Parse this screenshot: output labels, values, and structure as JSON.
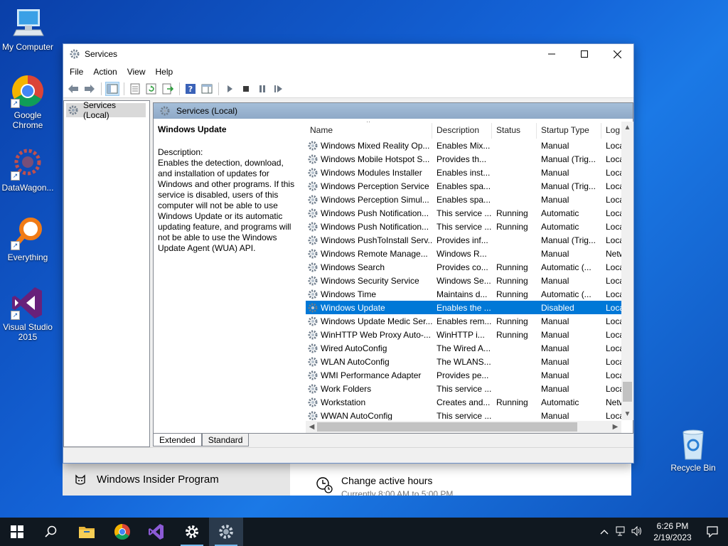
{
  "desktop": {
    "icons": [
      {
        "label": "My Computer"
      },
      {
        "label": "Google Chrome"
      },
      {
        "label": "DataWagon..."
      },
      {
        "label": "Everything"
      },
      {
        "label": "Visual Studio 2015"
      },
      {
        "label": "Recycle Bin"
      }
    ]
  },
  "window": {
    "title": "Services",
    "menu": [
      "File",
      "Action",
      "View",
      "Help"
    ],
    "tree_item": "Services (Local)",
    "pane_header": "Services (Local)",
    "selected_service": "Windows Update",
    "description_label": "Description:",
    "description_text": "Enables the detection, download, and installation of updates for Windows and other programs. If this service is disabled, users of this computer will not be able to use Windows Update or its automatic updating feature, and programs will not be able to use the Windows Update Agent (WUA) API.",
    "columns": {
      "name": "Name",
      "description": "Description",
      "status": "Status",
      "startup": "Startup Type",
      "log": "Log"
    },
    "rows": [
      {
        "name": "Windows Mixed Reality Op...",
        "description": "Enables Mix...",
        "status": "",
        "startup": "Manual",
        "log": "Loca"
      },
      {
        "name": "Windows Mobile Hotspot S...",
        "description": "Provides th...",
        "status": "",
        "startup": "Manual (Trig...",
        "log": "Loca"
      },
      {
        "name": "Windows Modules Installer",
        "description": "Enables inst...",
        "status": "",
        "startup": "Manual",
        "log": "Loca"
      },
      {
        "name": "Windows Perception Service",
        "description": "Enables spa...",
        "status": "",
        "startup": "Manual (Trig...",
        "log": "Loca"
      },
      {
        "name": "Windows Perception Simul...",
        "description": "Enables spa...",
        "status": "",
        "startup": "Manual",
        "log": "Loca"
      },
      {
        "name": "Windows Push Notification...",
        "description": "This service ...",
        "status": "Running",
        "startup": "Automatic",
        "log": "Loca"
      },
      {
        "name": "Windows Push Notification...",
        "description": "This service ...",
        "status": "Running",
        "startup": "Automatic",
        "log": "Loca"
      },
      {
        "name": "Windows PushToInstall Serv...",
        "description": "Provides inf...",
        "status": "",
        "startup": "Manual (Trig...",
        "log": "Loca"
      },
      {
        "name": "Windows Remote Manage...",
        "description": "Windows R...",
        "status": "",
        "startup": "Manual",
        "log": "Netw"
      },
      {
        "name": "Windows Search",
        "description": "Provides co...",
        "status": "Running",
        "startup": "Automatic (...",
        "log": "Loca"
      },
      {
        "name": "Windows Security Service",
        "description": "Windows Se...",
        "status": "Running",
        "startup": "Manual",
        "log": "Loca"
      },
      {
        "name": "Windows Time",
        "description": "Maintains d...",
        "status": "Running",
        "startup": "Automatic (...",
        "log": "Loca"
      },
      {
        "name": "Windows Update",
        "description": "Enables the ...",
        "status": "",
        "startup": "Disabled",
        "log": "Loca",
        "selected": true
      },
      {
        "name": "Windows Update Medic Ser...",
        "description": "Enables rem...",
        "status": "Running",
        "startup": "Manual",
        "log": "Loca"
      },
      {
        "name": "WinHTTP Web Proxy Auto-...",
        "description": "WinHTTP i...",
        "status": "Running",
        "startup": "Manual",
        "log": "Loca"
      },
      {
        "name": "Wired AutoConfig",
        "description": "The Wired A...",
        "status": "",
        "startup": "Manual",
        "log": "Loca"
      },
      {
        "name": "WLAN AutoConfig",
        "description": "The WLANS...",
        "status": "",
        "startup": "Manual",
        "log": "Loca"
      },
      {
        "name": "WMI Performance Adapter",
        "description": "Provides pe...",
        "status": "",
        "startup": "Manual",
        "log": "Loca"
      },
      {
        "name": "Work Folders",
        "description": "This service ...",
        "status": "",
        "startup": "Manual",
        "log": "Loca"
      },
      {
        "name": "Workstation",
        "description": "Creates and...",
        "status": "Running",
        "startup": "Automatic",
        "log": "Netw"
      },
      {
        "name": "WWAN AutoConfig",
        "description": "This service ...",
        "status": "",
        "startup": "Manual",
        "log": "Loca"
      }
    ],
    "tabs": {
      "extended": "Extended",
      "standard": "Standard"
    }
  },
  "settings_window": {
    "left_label": "Windows Insider Program",
    "right_title": "Change active hours",
    "right_sub": "Currently 8:00 AM to 5:00 PM"
  },
  "taskbar": {
    "time": "6:26 PM",
    "date": "2/19/2023"
  },
  "colors": {
    "selection": "#0078d7",
    "taskbar": "#101820",
    "desktop": "#1464d8"
  }
}
